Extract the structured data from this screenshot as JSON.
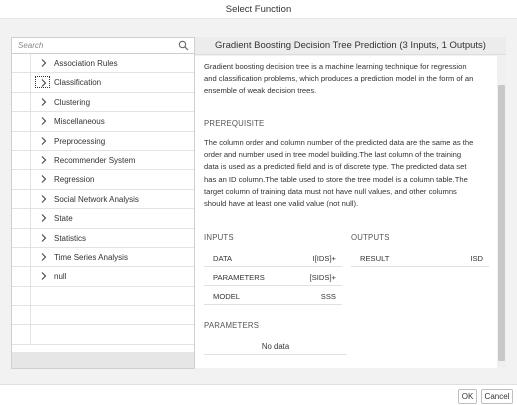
{
  "window": {
    "title": "Select Function"
  },
  "search": {
    "placeholder": "Search"
  },
  "tree": {
    "items": [
      {
        "label": "Association Rules"
      },
      {
        "label": "Classification"
      },
      {
        "label": "Clustering"
      },
      {
        "label": "Miscellaneous"
      },
      {
        "label": "Preprocessing"
      },
      {
        "label": "Recommender System"
      },
      {
        "label": "Regression"
      },
      {
        "label": "Social Network Analysis"
      },
      {
        "label": "State"
      },
      {
        "label": "Statistics"
      },
      {
        "label": "Time Series Analysis"
      },
      {
        "label": "null"
      }
    ]
  },
  "detail": {
    "title": "Gradient Boosting Decision Tree Prediction (3 Inputs, 1 Outputs)",
    "description": [
      "Gradient boosting decision tree is a machine learning technique for regression",
      "and classification problems, which produces a prediction model in the form of an",
      "ensemble of weak decision trees."
    ],
    "prerequisite_heading": "PREREQUISITE",
    "prerequisite": [
      "The column order and column number of the predicted data are the same as the",
      "order and number used in tree model building.The last column of the training",
      "data is used as a predicted field and is of discrete type. The predicted data set",
      "has an ID column.The table used to store the tree model is a column table.The",
      "target column of training data must not have null values, and other columns",
      "should have at least one valid value (not null)."
    ],
    "inputs_heading": "INPUTS",
    "inputs": [
      {
        "name": "DATA",
        "type": "I[IDS]+"
      },
      {
        "name": "PARAMETERS",
        "type": "[SIDS]+"
      },
      {
        "name": "MODEL",
        "type": "SSS"
      }
    ],
    "outputs_heading": "OUTPUTS",
    "outputs": [
      {
        "name": "RESULT",
        "type": "ISD"
      }
    ],
    "parameters_heading": "PARAMETERS",
    "parameters_empty": "No data"
  },
  "footer": {
    "ok_label": "OK",
    "cancel_label": "Cancel"
  },
  "icons": {
    "search": "search-icon",
    "chevron": "chevron-right-icon"
  }
}
